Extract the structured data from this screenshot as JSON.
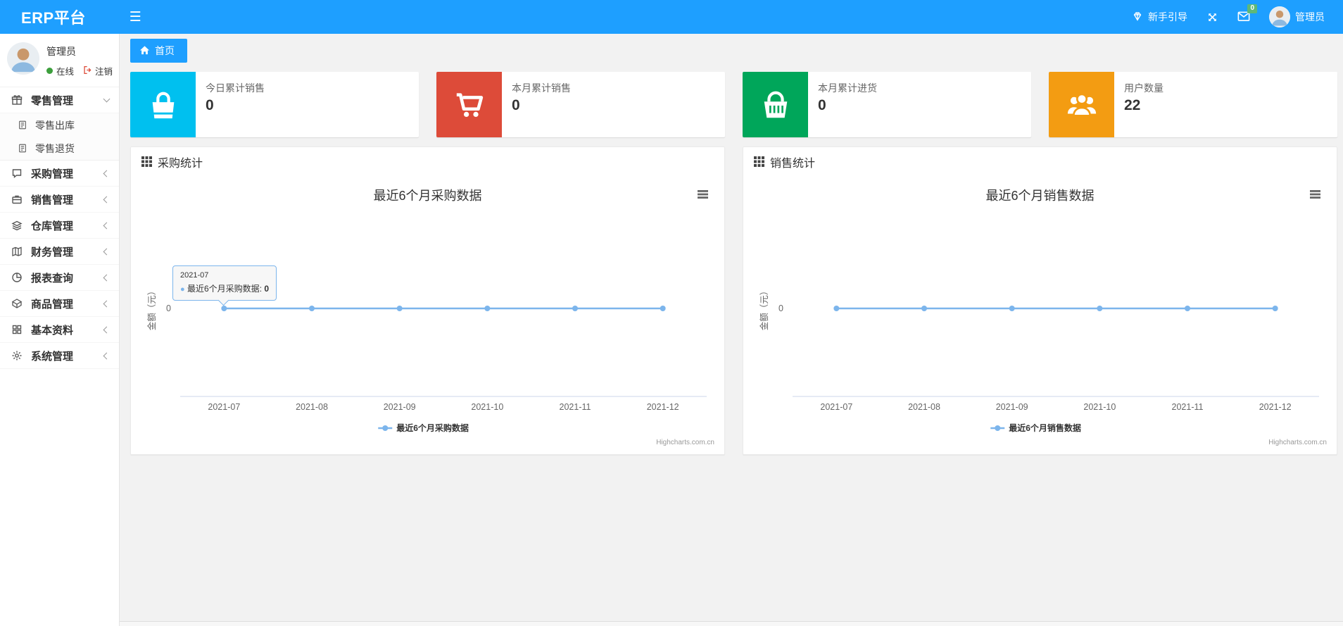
{
  "colors": {
    "navbar": "#1E9FFF",
    "badge_green": "#5FB878",
    "stat_cyan": "#00c0ef",
    "stat_red": "#dd4b39",
    "stat_green": "#00a65a",
    "stat_orange": "#f39c12",
    "chart_line": "#7cb5ec"
  },
  "navbar": {
    "brand": "ERP平台",
    "menu_toggle_icon": "hamburger-icon",
    "guide_label": "新手引导",
    "mail_badge": "0",
    "username": "管理员"
  },
  "sidebar": {
    "user": {
      "name": "管理员",
      "status_label": "在线",
      "logout_label": "注销"
    },
    "menu": [
      {
        "label": "零售管理",
        "icon": "gift-icon",
        "expanded": true
      },
      {
        "label": "零售出库",
        "icon": "file-icon"
      },
      {
        "label": "零售退货",
        "icon": "file-icon"
      },
      {
        "label": "采购管理",
        "icon": "chat-icon"
      },
      {
        "label": "销售管理",
        "icon": "briefcase-icon"
      },
      {
        "label": "仓库管理",
        "icon": "layers-icon"
      },
      {
        "label": "财务管理",
        "icon": "map-book-icon"
      },
      {
        "label": "报表查询",
        "icon": "pie-chart-icon"
      },
      {
        "label": "商品管理",
        "icon": "box-icon"
      },
      {
        "label": "基本资料",
        "icon": "grid-icon"
      },
      {
        "label": "系统管理",
        "icon": "gear-icon"
      }
    ]
  },
  "breadcrumb": {
    "home_label": "首页"
  },
  "stats": [
    {
      "title": "今日累计销售",
      "value": "0",
      "color": "#00c0ef",
      "icon": "shopping-bag-icon"
    },
    {
      "title": "本月累计销售",
      "value": "0",
      "color": "#dd4b39",
      "icon": "shopping-cart-icon"
    },
    {
      "title": "本月累计进货",
      "value": "0",
      "color": "#00a65a",
      "icon": "shopping-basket-icon"
    },
    {
      "title": "用户数量",
      "value": "22",
      "color": "#f39c12",
      "icon": "users-icon"
    }
  ],
  "panels": [
    {
      "header": "采购统计"
    },
    {
      "header": "销售统计"
    }
  ],
  "chart_data": [
    {
      "type": "line",
      "title": "最近6个月采购数据",
      "categories": [
        "2021-07",
        "2021-08",
        "2021-09",
        "2021-10",
        "2021-11",
        "2021-12"
      ],
      "series": [
        {
          "name": "最近6个月采购数据",
          "values": [
            0,
            0,
            0,
            0,
            0,
            0
          ]
        }
      ],
      "xlabel": "",
      "ylabel": "金额（元）",
      "ytick": "0",
      "ylim": [
        -1,
        1
      ],
      "grid": false,
      "legend_position": "bottom",
      "line_color": "#7cb5ec",
      "credits": "Highcharts.com.cn",
      "tooltip": {
        "header": "2021-07",
        "series_label": "最近6个月采购数据",
        "value": "0"
      }
    },
    {
      "type": "line",
      "title": "最近6个月销售数据",
      "categories": [
        "2021-07",
        "2021-08",
        "2021-09",
        "2021-10",
        "2021-11",
        "2021-12"
      ],
      "series": [
        {
          "name": "最近6个月销售数据",
          "values": [
            0,
            0,
            0,
            0,
            0,
            0
          ]
        }
      ],
      "xlabel": "",
      "ylabel": "金额（元）",
      "ytick": "0",
      "ylim": [
        -1,
        1
      ],
      "grid": false,
      "legend_position": "bottom",
      "line_color": "#7cb5ec",
      "credits": "Highcharts.com.cn"
    }
  ]
}
